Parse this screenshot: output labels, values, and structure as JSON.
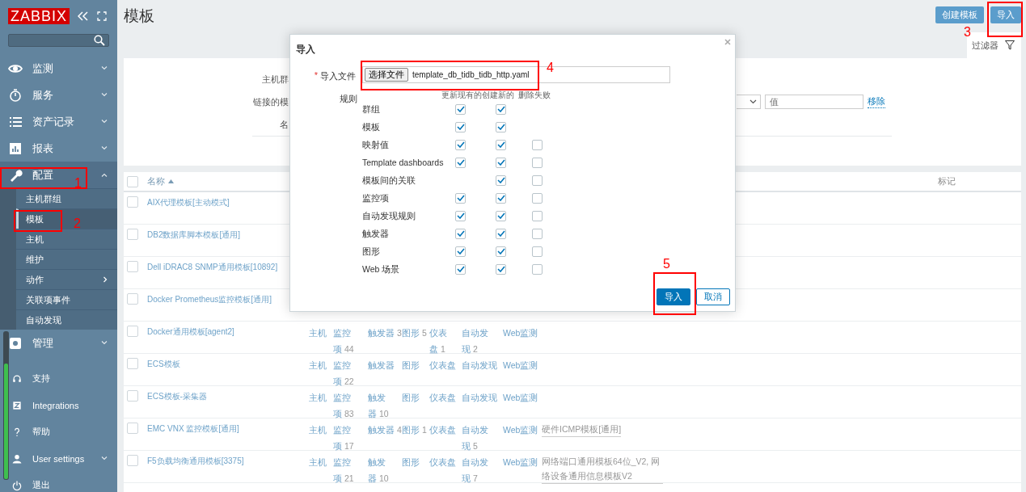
{
  "sidebar": {
    "logo": "ZABBIX",
    "menu": [
      {
        "label": "监测",
        "expanded": false
      },
      {
        "label": "服务",
        "expanded": false
      },
      {
        "label": "资产记录",
        "expanded": false
      },
      {
        "label": "报表",
        "expanded": false
      },
      {
        "label": "配置",
        "expanded": true,
        "children": [
          {
            "label": "主机群组",
            "selected": false
          },
          {
            "label": "模板",
            "selected": true
          },
          {
            "label": "主机",
            "selected": false
          },
          {
            "label": "维护",
            "selected": false
          },
          {
            "label": "动作",
            "selected": false,
            "submenu": true
          },
          {
            "label": "关联项事件",
            "selected": false
          },
          {
            "label": "自动发现",
            "selected": false
          }
        ]
      },
      {
        "label": "管理",
        "expanded": false
      }
    ],
    "bottom": [
      {
        "label": "支持",
        "dropdown": false
      },
      {
        "label": "Integrations",
        "dropdown": false
      },
      {
        "label": "帮助",
        "dropdown": false
      },
      {
        "label": "User settings",
        "dropdown": true
      },
      {
        "label": "退出",
        "dropdown": false
      }
    ]
  },
  "page": {
    "title": "模板",
    "buttons": [
      "创建模板",
      "导入"
    ]
  },
  "filter": {
    "tab": "过滤器",
    "labels": [
      "主机群",
      "链接的模",
      "名"
    ],
    "value_placeholder": "值",
    "remove_link": "移除"
  },
  "table": {
    "columns": [
      "名称",
      "标记"
    ],
    "select_all": false,
    "rows": [
      {
        "name": "AIX代理模板[主动模式]",
        "selected": false
      },
      {
        "name": "DB2数据库脚本模板[通用]",
        "selected": false
      },
      {
        "name": "Dell iDRAC8 SNMP通用模板[10892]",
        "selected": false
      },
      {
        "name": "Docker Prometheus监控模板[通用]",
        "selected": false
      },
      {
        "name": "Docker通用模板[agent2]",
        "selected": false,
        "cells": [
          {
            "label": "主机"
          },
          {
            "label": "监控项",
            "count": "44"
          },
          {
            "label": "触发器",
            "count": "3"
          },
          {
            "label": "图形",
            "count": "5"
          },
          {
            "label": "仪表盘",
            "count": "1"
          },
          {
            "label": "自动发现",
            "count": "2"
          },
          {
            "label": "Web监测"
          }
        ]
      },
      {
        "name": "ECS模板",
        "selected": false,
        "cells": [
          {
            "label": "主机"
          },
          {
            "label": "监控项",
            "count": "22"
          },
          {
            "label": "触发器"
          },
          {
            "label": "图形"
          },
          {
            "label": "仪表盘"
          },
          {
            "label": "自动发现"
          },
          {
            "label": "Web监测"
          }
        ]
      },
      {
        "name": "ECS模板-采集器",
        "selected": false,
        "cells": [
          {
            "label": "主机"
          },
          {
            "label": "监控项",
            "count": "83"
          },
          {
            "label": "触发器",
            "count": "10"
          },
          {
            "label": "图形"
          },
          {
            "label": "仪表盘"
          },
          {
            "label": "自动发现"
          },
          {
            "label": "Web监测"
          }
        ]
      },
      {
        "name": "EMC VNX 监控模板[通用]",
        "selected": false,
        "cells": [
          {
            "label": "主机"
          },
          {
            "label": "监控项",
            "count": "17"
          },
          {
            "label": "触发器",
            "count": "4"
          },
          {
            "label": "图形",
            "count": "1"
          },
          {
            "label": "仪表盘"
          },
          {
            "label": "自动发现",
            "count": "5"
          },
          {
            "label": "Web监测"
          }
        ],
        "linked": "硬件ICMP模板[通用]"
      },
      {
        "name": "F5负载均衡通用模板[3375]",
        "selected": false,
        "cells": [
          {
            "label": "主机"
          },
          {
            "label": "监控项",
            "count": "21"
          },
          {
            "label": "触发器",
            "count": "10"
          },
          {
            "label": "图形"
          },
          {
            "label": "仪表盘"
          },
          {
            "label": "自动发现",
            "count": "7"
          },
          {
            "label": "Web监测"
          }
        ],
        "linked": "网络端口通用模板64位_V2, 网络设备通用信息模板V2"
      }
    ]
  },
  "dialog": {
    "title": "导入",
    "required_mark": "*",
    "file_label": "导入文件",
    "file_button": "选择文件",
    "file_name": "template_db_tidb_tidb_http.yaml",
    "rules_label": "规则",
    "rule_columns": [
      "更新现有的",
      "创建新的",
      "删除失败"
    ],
    "rules": [
      {
        "name": "群组",
        "update": true,
        "create": true
      },
      {
        "name": "模板",
        "update": true,
        "create": true
      },
      {
        "name": "映射值",
        "update": true,
        "create": true,
        "delete": false
      },
      {
        "name": "Template dashboards",
        "update": true,
        "create": true,
        "delete": false
      },
      {
        "name": "模板间的关联",
        "create": true,
        "delete": false
      },
      {
        "name": "监控项",
        "update": true,
        "create": true,
        "delete": false
      },
      {
        "name": "自动发现规则",
        "update": true,
        "create": true,
        "delete": false
      },
      {
        "name": "触发器",
        "update": true,
        "create": true,
        "delete": false
      },
      {
        "name": "图形",
        "update": true,
        "create": true,
        "delete": false
      },
      {
        "name": "Web 场景",
        "update": true,
        "create": true,
        "delete": false
      }
    ],
    "buttons": [
      {
        "label": "导入",
        "primary": true
      },
      {
        "label": "取消",
        "primary": false
      }
    ]
  },
  "annotations": [
    "1",
    "2",
    "3",
    "4",
    "5"
  ]
}
